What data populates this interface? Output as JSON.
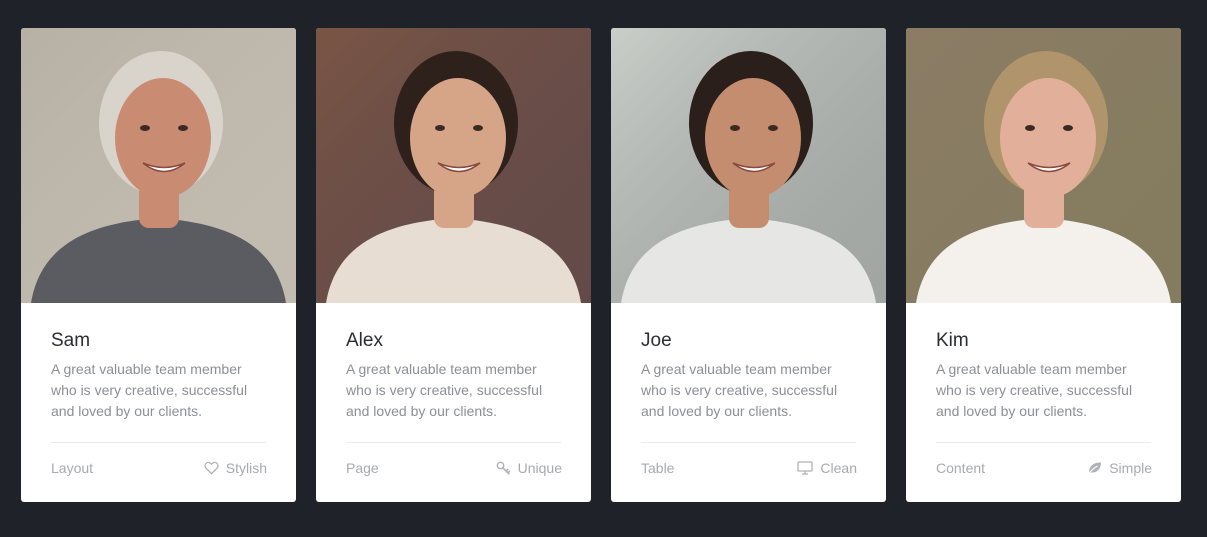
{
  "team": [
    {
      "name": "Sam",
      "description": "A great valuable team member who is very creative, successful and loved by our clients.",
      "tag": "Layout",
      "feature": "Stylish",
      "feature_icon": "heart-icon",
      "photo_colors": {
        "bg": "#b7b0a4",
        "skin": "#c98c72",
        "hair": "#d8d4cc",
        "shirt": "#5b5c61",
        "accent": "#e6e2d6"
      }
    },
    {
      "name": "Alex",
      "description": "A great valuable team member who is very creative, successful and loved by our clients.",
      "tag": "Page",
      "feature": "Unique",
      "feature_icon": "key-icon",
      "photo_colors": {
        "bg": "#7a5545",
        "skin": "#d6a487",
        "hair": "#2e211c",
        "shirt": "#e7ddd2",
        "accent": "#1e2a52"
      }
    },
    {
      "name": "Joe",
      "description": "A great valuable team member who is very creative, successful and loved by our clients.",
      "tag": "Table",
      "feature": "Clean",
      "feature_icon": "monitor-icon",
      "photo_colors": {
        "bg": "#c9cec9",
        "skin": "#c48d70",
        "hair": "#2a1f1a",
        "shirt": "#e6e7e4",
        "accent": "#2b2b2e"
      }
    },
    {
      "name": "Kim",
      "description": "A great valuable team member who is very creative, successful and loved by our clients.",
      "tag": "Content",
      "feature": "Simple",
      "feature_icon": "leaf-icon",
      "photo_colors": {
        "bg": "#8c7c65",
        "skin": "#e2b09a",
        "hair": "#b0956c",
        "shirt": "#f4f1ec",
        "accent": "#6e7b4f"
      }
    }
  ]
}
